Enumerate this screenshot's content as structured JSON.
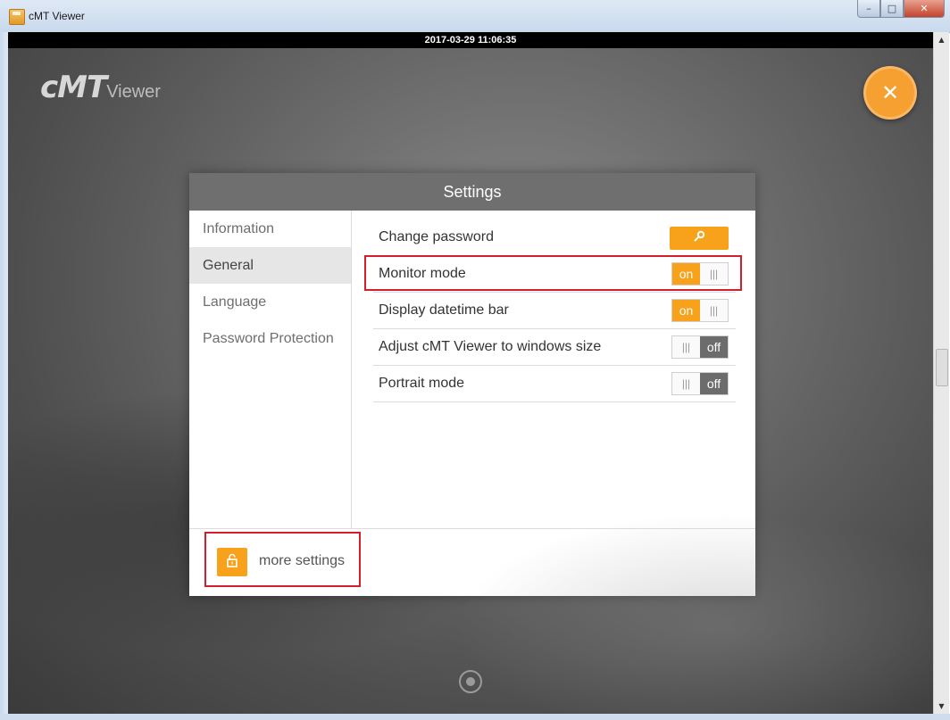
{
  "window": {
    "title": "cMT Viewer",
    "min_label": "–",
    "max_label": "□",
    "close_label": "✕"
  },
  "datetime_bar": "2017-03-29 11:06:35",
  "logo": {
    "main": "cMT",
    "sub": "Viewer"
  },
  "close_fab_icon": "✕",
  "dialog": {
    "title": "Settings",
    "sidebar": [
      {
        "label": "Information"
      },
      {
        "label": "General"
      },
      {
        "label": "Language"
      },
      {
        "label": "Password Protection"
      }
    ],
    "rows": {
      "change_password": {
        "label": "Change password",
        "icon": "key-icon"
      },
      "monitor_mode": {
        "label": "Monitor mode",
        "state": "on"
      },
      "datetime_bar": {
        "label": "Display datetime bar",
        "state": "on"
      },
      "adjust_window": {
        "label": "Adjust cMT Viewer to windows size",
        "state": "off"
      },
      "portrait_mode": {
        "label": "Portrait mode",
        "state": "off"
      }
    },
    "toggle_text": {
      "on": "on",
      "off": "off",
      "grip": "|||"
    },
    "footer": {
      "more_settings": "more settings",
      "icon": "unlock-icon"
    }
  },
  "colors": {
    "accent": "#f7a21a",
    "header": "#6f6f6f",
    "highlight": "#d21f2b",
    "toggle_off": "#6c6c6c"
  }
}
